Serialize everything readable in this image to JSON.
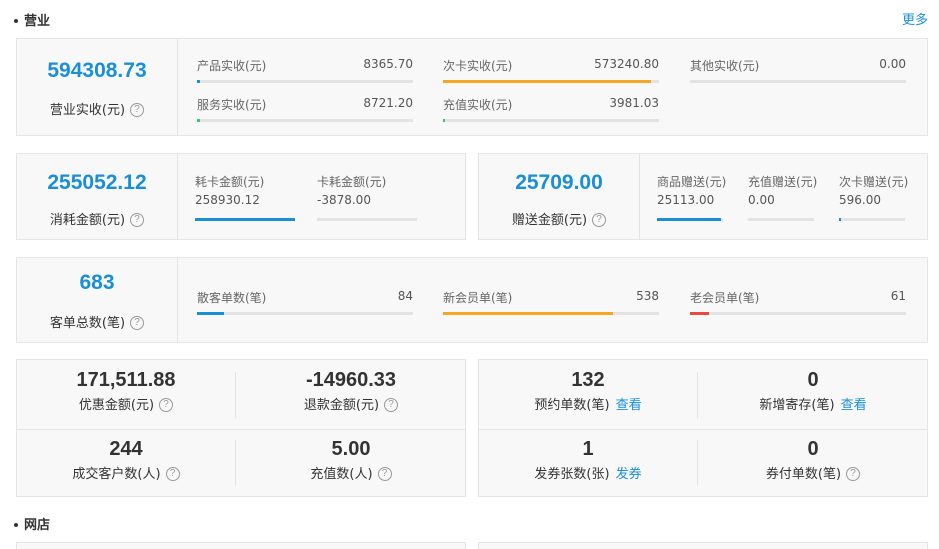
{
  "sections": {
    "business": "营业",
    "more": "更多",
    "online": "网店"
  },
  "revenue": {
    "total_value": "594308.73",
    "total_label": "营业实收(元)",
    "items": [
      {
        "label": "产品实收(元)",
        "value": "8365.70",
        "color": "#1a8fd8",
        "fraction": 0.015
      },
      {
        "label": "次卡实收(元)",
        "value": "573240.80",
        "color": "#f5a623",
        "fraction": 0.965
      },
      {
        "label": "其他实收(元)",
        "value": "0.00",
        "color": "#e74c3c",
        "fraction": 0.0
      },
      {
        "label": "服务实收(元)",
        "value": "8721.20",
        "color": "#2ecc71",
        "fraction": 0.015
      },
      {
        "label": "充值实收(元)",
        "value": "3981.03",
        "color": "#2ecc71",
        "fraction": 0.007
      }
    ]
  },
  "consumption": {
    "total_value": "255052.12",
    "total_label": "消耗金额(元)",
    "items": [
      {
        "label": "耗卡金额(元)",
        "value": "258930.12",
        "color": "#1a8fd8",
        "fraction": 1.0
      },
      {
        "label": "卡耗金额(元)",
        "value": "-3878.00",
        "color": "#1a8fd8",
        "fraction": 0.0
      }
    ]
  },
  "gift": {
    "total_value": "25709.00",
    "total_label": "赠送金额(元)",
    "items": [
      {
        "label": "商品赠送(元)",
        "value": "25113.00",
        "color": "#1a8fd8",
        "fraction": 0.977
      },
      {
        "label": "充值赠送(元)",
        "value": "0.00",
        "color": "#1a8fd8",
        "fraction": 0.0
      },
      {
        "label": "次卡赠送(元)",
        "value": "596.00",
        "color": "#1a8fd8",
        "fraction": 0.023
      }
    ]
  },
  "orders": {
    "total_value": "683",
    "total_label": "客单总数(笔)",
    "items": [
      {
        "label": "散客单数(笔)",
        "value": "84",
        "color": "#1a8fd8",
        "fraction": 0.123
      },
      {
        "label": "新会员单(笔)",
        "value": "538",
        "color": "#f5a623",
        "fraction": 0.788
      },
      {
        "label": "老会员单(笔)",
        "value": "61",
        "color": "#e74c3c",
        "fraction": 0.089
      }
    ]
  },
  "stats_left": [
    {
      "value": "171,511.88",
      "label": "优惠金额(元)"
    },
    {
      "value": "-14960.33",
      "label": "退款金额(元)"
    },
    {
      "value": "244",
      "label": "成交客户数(人)"
    },
    {
      "value": "5.00",
      "label": "充值数(人)"
    }
  ],
  "stats_right": [
    {
      "value": "132",
      "label": "预约单数(笔)",
      "link": "查看"
    },
    {
      "value": "0",
      "label": "新增寄存(笔)",
      "link": "查看"
    },
    {
      "value": "1",
      "label": "发券张数(张)",
      "link": "发券"
    },
    {
      "value": "0",
      "label": "券付单数(笔)"
    }
  ],
  "help_glyph": "?"
}
